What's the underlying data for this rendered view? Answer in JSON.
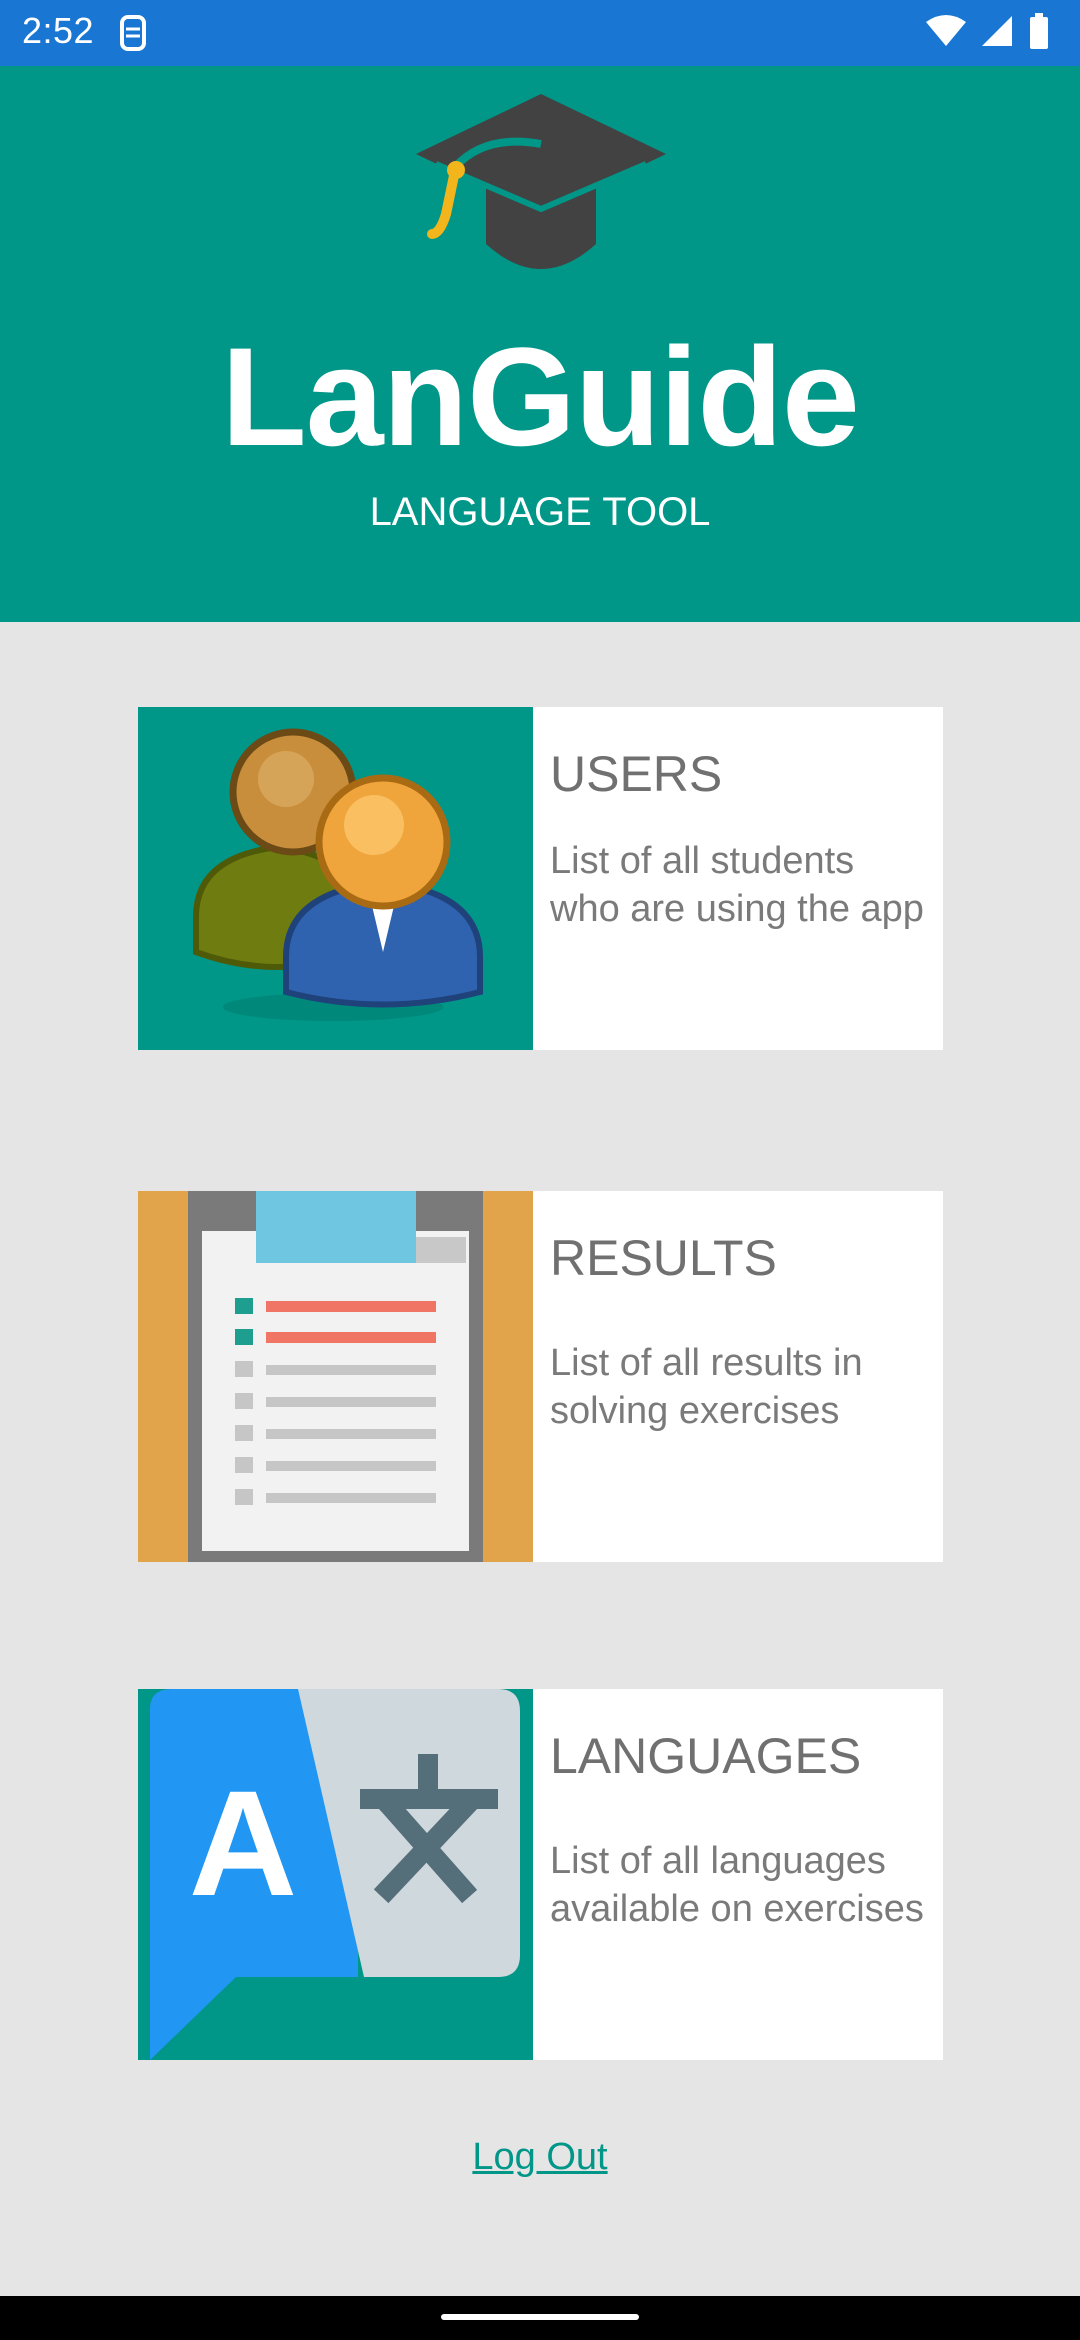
{
  "status_bar": {
    "time": "2:52",
    "icons": [
      "sim-card-icon",
      "wifi-icon",
      "signal-icon",
      "battery-icon"
    ],
    "color": "#1976d2"
  },
  "header": {
    "title": "LanGuide",
    "subtitle": "LANGUAGE TOOL",
    "icon": "graduation-cap-icon",
    "color": "#009688"
  },
  "cards": [
    {
      "title": "USERS",
      "description": "List of all students who are using the app",
      "icon": "users-icon",
      "image_bg": "#009688"
    },
    {
      "title": "RESULTS",
      "description": "List of all results in solving exercises",
      "icon": "clipboard-icon",
      "image_bg": "#e2a44a"
    },
    {
      "title": "LANGUAGES",
      "description": "List of all languages available on exercises",
      "icon": "translate-icon",
      "image_bg": "#009688"
    }
  ],
  "logout_label": "Log Out",
  "colors": {
    "background": "#e5e5e5",
    "accent": "#009688",
    "card_text": "#707070"
  }
}
